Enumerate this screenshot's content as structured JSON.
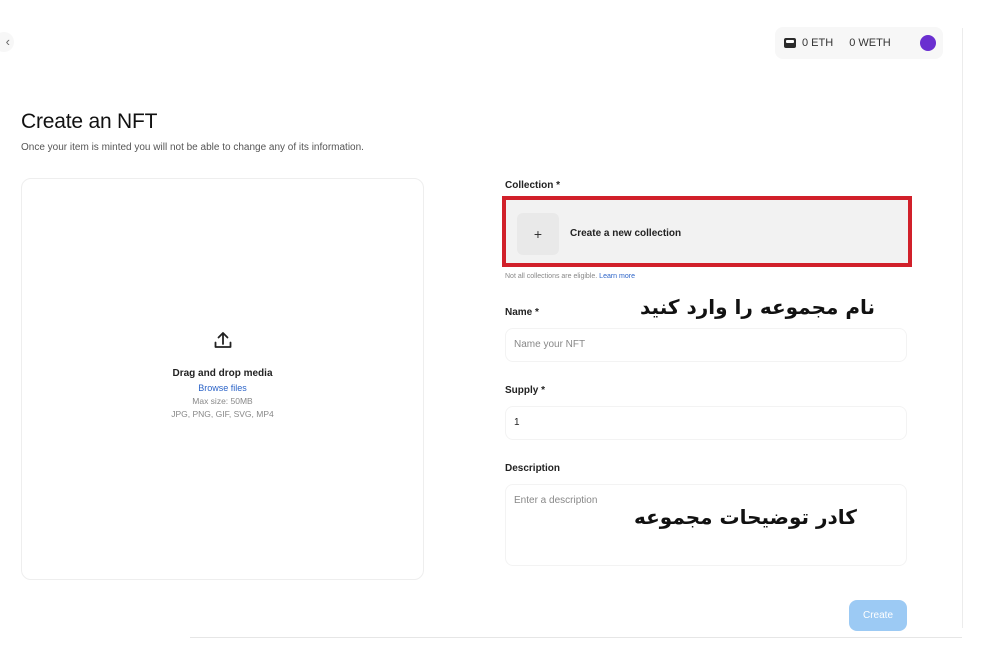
{
  "header": {
    "back_icon": "chevron-left-icon",
    "wallet": {
      "icon": "wallet-icon",
      "eth": "0 ETH",
      "weth": "0 WETH",
      "avatar_color": "#6a2fd0"
    }
  },
  "page": {
    "title": "Create an NFT",
    "subtitle": "Once your item is minted you will not be able to change any of its information."
  },
  "media_upload": {
    "icon": "upload-icon",
    "title": "Drag and drop media",
    "browse_label": "Browse files",
    "max_size": "Max size: 50MB",
    "formats": "JPG, PNG, GIF, SVG, MP4"
  },
  "form": {
    "collection": {
      "label": "Collection *",
      "plus": "+",
      "create_label": "Create a new collection",
      "note": "Not all collections are eligible.",
      "learn_more": "Learn more"
    },
    "name": {
      "label": "Name *",
      "placeholder": "Name your NFT"
    },
    "supply": {
      "label": "Supply *",
      "value": "1"
    },
    "description": {
      "label": "Description",
      "placeholder": "Enter a description"
    },
    "create_button": "Create"
  },
  "annotations": {
    "name_hint": "نام مجموعه را وارد کنید",
    "description_hint": "کادر توضیحات مجموعه"
  },
  "colors": {
    "highlight_border": "#d1202a",
    "link": "#2c64c8",
    "button_disabled": "#9ccaf4"
  }
}
